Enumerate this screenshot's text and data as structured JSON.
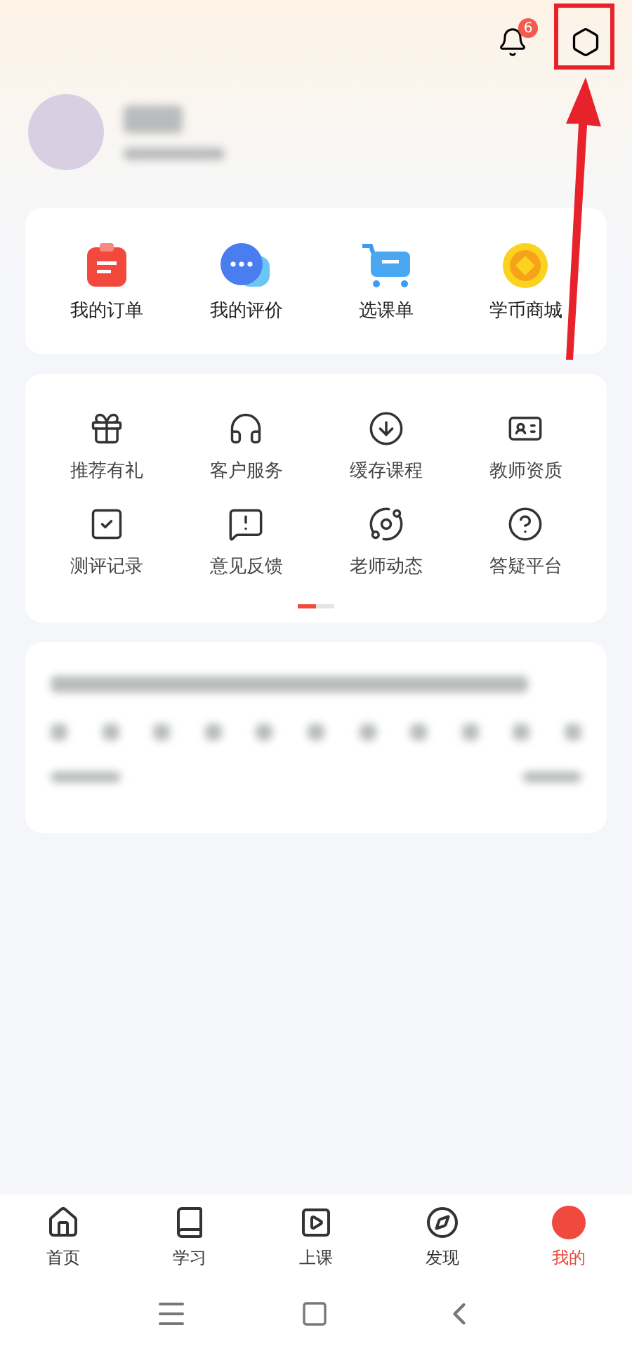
{
  "header": {
    "notification_count": "6"
  },
  "quick_links": [
    {
      "kind": "order",
      "label": "我的订单"
    },
    {
      "kind": "review",
      "label": "我的评价"
    },
    {
      "kind": "cart",
      "label": "选课单"
    },
    {
      "kind": "coin",
      "label": "学币商城"
    }
  ],
  "services": [
    {
      "kind": "gift",
      "label": "推荐有礼"
    },
    {
      "kind": "headset",
      "label": "客户服务"
    },
    {
      "kind": "download",
      "label": "缓存课程"
    },
    {
      "kind": "certificate",
      "label": "教师资质"
    },
    {
      "kind": "record",
      "label": "测评记录"
    },
    {
      "kind": "feedback",
      "label": "意见反馈"
    },
    {
      "kind": "planet",
      "label": "老师动态"
    },
    {
      "kind": "question",
      "label": "答疑平台"
    }
  ],
  "service_pages": [
    {
      "selected": true
    },
    {
      "selected": false
    }
  ],
  "tabs": [
    {
      "kind": "home",
      "label": "首页",
      "selected": false
    },
    {
      "kind": "study",
      "label": "学习",
      "selected": false
    },
    {
      "kind": "class",
      "label": "上课",
      "selected": false
    },
    {
      "kind": "discover",
      "label": "发现",
      "selected": false
    },
    {
      "kind": "me",
      "label": "我的",
      "selected": true
    }
  ]
}
